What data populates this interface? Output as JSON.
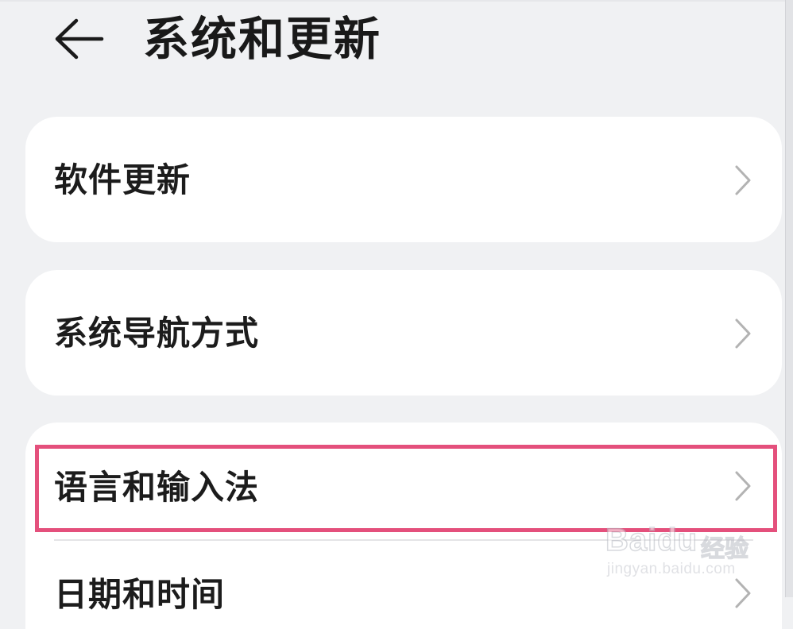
{
  "header": {
    "title": "系统和更新",
    "back_icon": "back-arrow-icon"
  },
  "menu": {
    "items": [
      {
        "label": "软件更新",
        "icon": "chevron-right-icon"
      },
      {
        "label": "系统导航方式",
        "icon": "chevron-right-icon"
      },
      {
        "label": "语言和输入法",
        "icon": "chevron-right-icon",
        "highlighted": true
      },
      {
        "label": "日期和时间",
        "icon": "chevron-right-icon"
      }
    ]
  },
  "overlay": {
    "highlight_color": "#e4507c"
  },
  "watermark": {
    "brand": "Baidu",
    "jingyan": "经验",
    "url": "jingyan.baidu.com"
  },
  "colors": {
    "background": "#f0f1f3",
    "card": "#ffffff",
    "text": "#1c1c1c",
    "chevron": "#b3b3b3"
  }
}
